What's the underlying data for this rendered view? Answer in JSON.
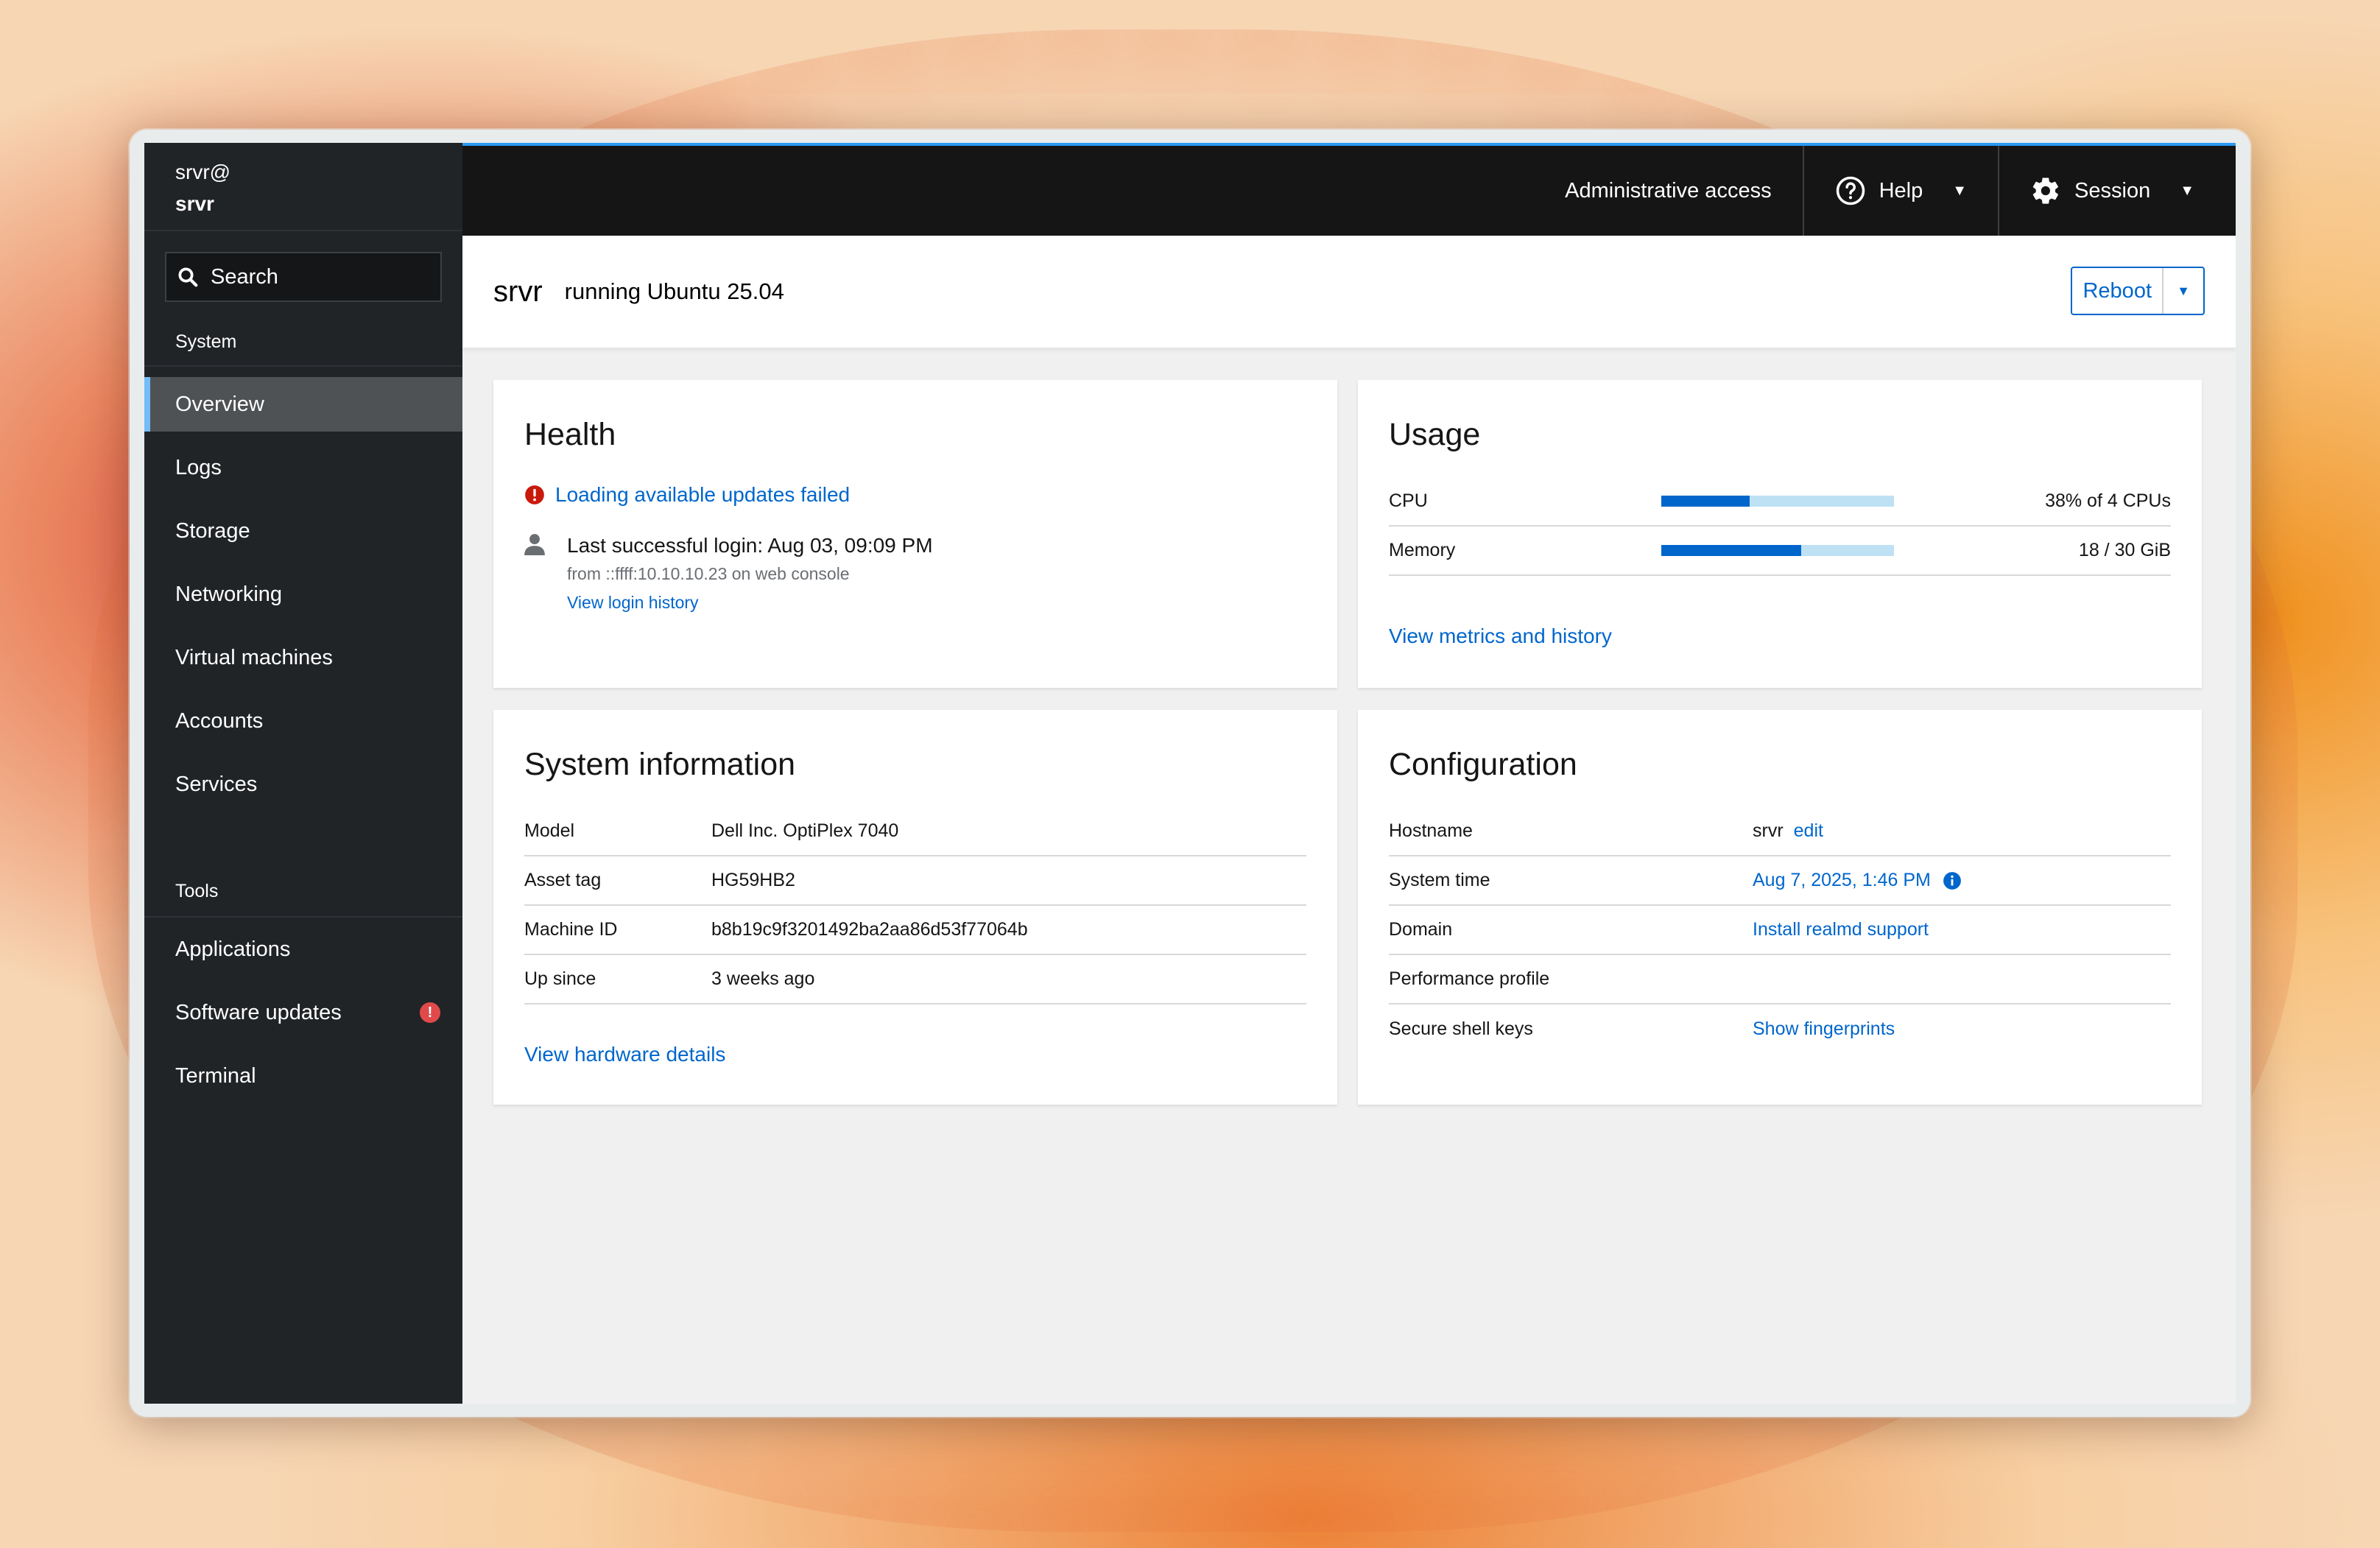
{
  "sidebar": {
    "host_user": "srvr@",
    "host_name": "srvr",
    "search_label": "Search",
    "system_label": "System",
    "system_items": [
      {
        "label": "Overview",
        "active": true
      },
      {
        "label": "Logs"
      },
      {
        "label": "Storage"
      },
      {
        "label": "Networking"
      },
      {
        "label": "Virtual machines"
      },
      {
        "label": "Accounts"
      },
      {
        "label": "Services"
      }
    ],
    "tools_label": "Tools",
    "tools_items": [
      {
        "label": "Applications"
      },
      {
        "label": "Software updates",
        "badge": "!"
      },
      {
        "label": "Terminal"
      }
    ]
  },
  "topbar": {
    "admin_label": "Administrative access",
    "help_label": "Help",
    "session_label": "Session"
  },
  "page": {
    "hostname": "srvr",
    "os": "running Ubuntu 25.04",
    "reboot_label": "Reboot"
  },
  "health": {
    "title": "Health",
    "alert_text": "Loading available updates failed",
    "login_text": "Last successful login: Aug 03, 09:09 PM",
    "login_from": "from ::ffff:10.10.10.23 on web console",
    "login_history_link": "View login history"
  },
  "usage": {
    "title": "Usage",
    "rows": [
      {
        "label": "CPU",
        "value": "38% of 4 CPUs",
        "fraction": 0.38
      },
      {
        "label": "Memory",
        "value": "18 / 30 GiB",
        "fraction": 0.6
      }
    ],
    "metrics_link": "View metrics and history"
  },
  "system_info": {
    "title": "System information",
    "rows": [
      {
        "label": "Model",
        "value": "Dell Inc. OptiPlex 7040"
      },
      {
        "label": "Asset tag",
        "value": "HG59HB2"
      },
      {
        "label": "Machine ID",
        "value": "b8b19c9f3201492ba2aa86d53f77064b"
      },
      {
        "label": "Up since",
        "value": "3 weeks ago"
      }
    ],
    "hardware_link": "View hardware details"
  },
  "configuration": {
    "title": "Configuration",
    "rows": [
      {
        "label": "Hostname",
        "value": "srvr",
        "link": "edit"
      },
      {
        "label": "System time",
        "link": "Aug 7, 2025, 1:46 PM"
      },
      {
        "label": "Domain",
        "link": "Install realmd support"
      },
      {
        "label": "Performance profile",
        "value": ""
      },
      {
        "label": "Secure shell keys",
        "link": "Show fingerprints"
      }
    ]
  },
  "colors": {
    "accent": "#0066cc",
    "sidebar_bg": "#212427",
    "topbar_bg": "#151515",
    "danger": "#c9190b"
  }
}
